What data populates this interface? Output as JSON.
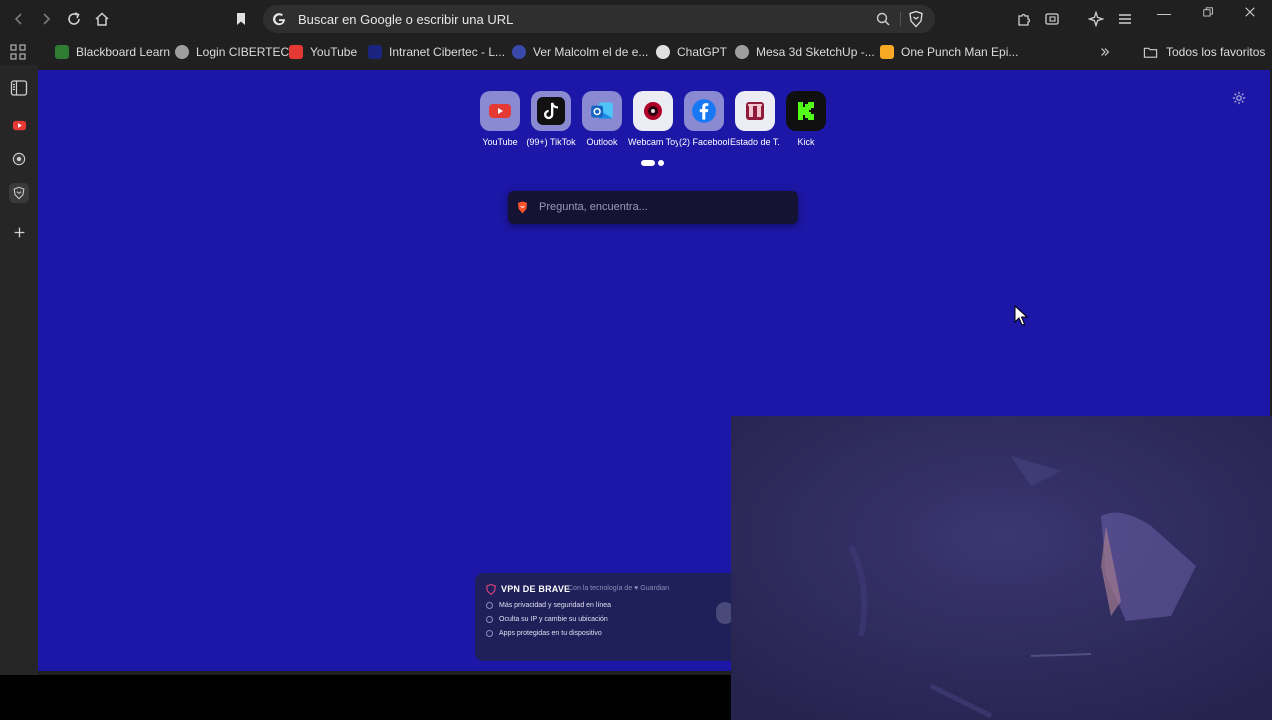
{
  "address_bar": {
    "text": "Buscar en Google o escribir una URL"
  },
  "bookmarks": [
    {
      "label": "Blackboard Learn",
      "color": "#2e7d32"
    },
    {
      "label": "Login CIBERTEC",
      "color": "#9e9e9e"
    },
    {
      "label": "YouTube",
      "color": "#e53935"
    },
    {
      "label": "Intranet Cibertec - L...",
      "color": "#1a237e"
    },
    {
      "label": "Ver Malcolm el de e...",
      "color": "#3949ab"
    },
    {
      "label": "ChatGPT",
      "color": "#e0e0e0"
    },
    {
      "label": "Mesa 3d SketchUp -...",
      "color": "#9e9e9e"
    },
    {
      "label": "One Punch Man Epi...",
      "color": "#f9a825"
    }
  ],
  "bookmarks_all": "Todos los favoritos",
  "shortcuts": [
    {
      "label": "YouTube",
      "icon": "youtube-icon",
      "color": "#e53935"
    },
    {
      "label": "(99+) TikTok",
      "icon": "tiktok-icon",
      "color": "#111111"
    },
    {
      "label": "Outlook",
      "icon": "outlook-icon",
      "color": "#1565c0"
    },
    {
      "label": "Webcam Toy",
      "icon": "webcam-icon",
      "color": "#b0002a"
    },
    {
      "label": "(2) Facebook",
      "icon": "facebook-icon",
      "color": "#1877f2"
    },
    {
      "label": "Estado de T...",
      "icon": "estado-icon",
      "color": "#8e1b3a"
    },
    {
      "label": "Kick",
      "icon": "kick-icon",
      "color": "#53fc18"
    }
  ],
  "search": {
    "placeholder": "Pregunta, encuentra..."
  },
  "vpn_card": {
    "title": "VPN DE BRAVE",
    "powered_by": "Con la tecnología de ♥ Guardian",
    "features": [
      "Más privacidad y seguridad en línea",
      "Oculta su IP y cambie su ubicación",
      "Apps protegidas en tu dispositivo"
    ]
  },
  "colors": {
    "background": "#1c17a6",
    "chrome": "#202020",
    "brave_accent": "#fb542b"
  }
}
